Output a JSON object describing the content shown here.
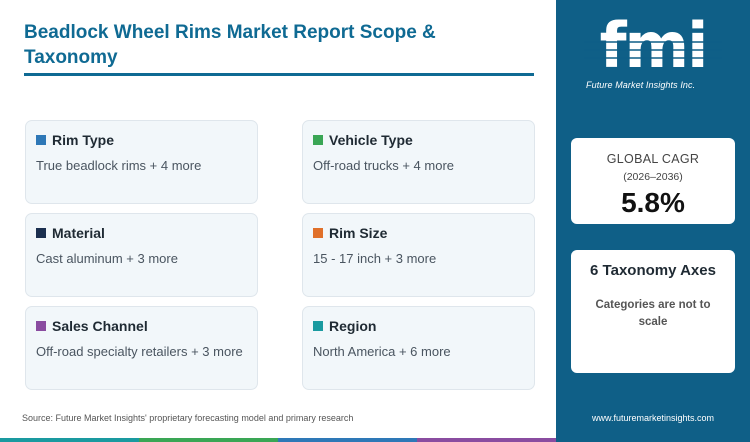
{
  "title": "Beadlock Wheel Rims Market Report Scope & Taxonomy",
  "cards": [
    {
      "label": "Rim Type",
      "value": "True beadlock rims + 4 more",
      "color": "#2e78b7"
    },
    {
      "label": "Vehicle Type",
      "value": "Off-road trucks + 4 more",
      "color": "#3aa655"
    },
    {
      "label": "Material",
      "value": "Cast aluminum + 3 more",
      "color": "#1b2f4f"
    },
    {
      "label": "Rim Size",
      "value": "15 - 17 inch + 3 more",
      "color": "#e0702a"
    },
    {
      "label": "Sales Channel",
      "value": "Off-road specialty retailers + 3 more",
      "color": "#8a4ca0"
    },
    {
      "label": "Region",
      "value": "North America + 6 more",
      "color": "#1a9aa0"
    }
  ],
  "source": "Source: Future Market Insights' proprietary forecasting model and primary research",
  "logo": {
    "mark": "fmi",
    "text": "Future Market Insights Inc."
  },
  "cagr": {
    "label": "GLOBAL CAGR",
    "period": "(2026–2036)",
    "value": "5.8%"
  },
  "taxonomy": {
    "title": "6 Taxonomy Axes",
    "subtitle": "Categories are not to scale"
  },
  "url": "www.futuremarketinsights.com",
  "colors": {
    "brand": "#0f6a93",
    "sidebar": "#0f5f87",
    "card_bg": "#f2f7fa"
  },
  "bottom_bar_colors": [
    "#1a9aa0",
    "#3aa655",
    "#2e78b7",
    "#8a4ca0"
  ]
}
